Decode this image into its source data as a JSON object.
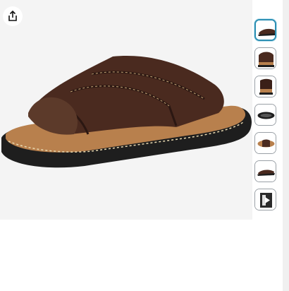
{
  "product_gallery": {
    "share_icon": "share-icon",
    "main_image": {
      "description_icon": "brown-leather-slide-sandal"
    },
    "thumbnails": [
      {
        "name": "thumb-1",
        "active": true
      },
      {
        "name": "thumb-2",
        "active": false
      },
      {
        "name": "thumb-3",
        "active": false
      },
      {
        "name": "thumb-4",
        "active": false
      },
      {
        "name": "thumb-5",
        "active": false
      },
      {
        "name": "thumb-6",
        "active": false
      },
      {
        "name": "thumb-7",
        "active": false
      }
    ],
    "colors": {
      "accent": "#2c8fb3",
      "leather": "#4a2a1f",
      "footbed": "#b8804d",
      "sole": "#1e1e1e"
    }
  }
}
